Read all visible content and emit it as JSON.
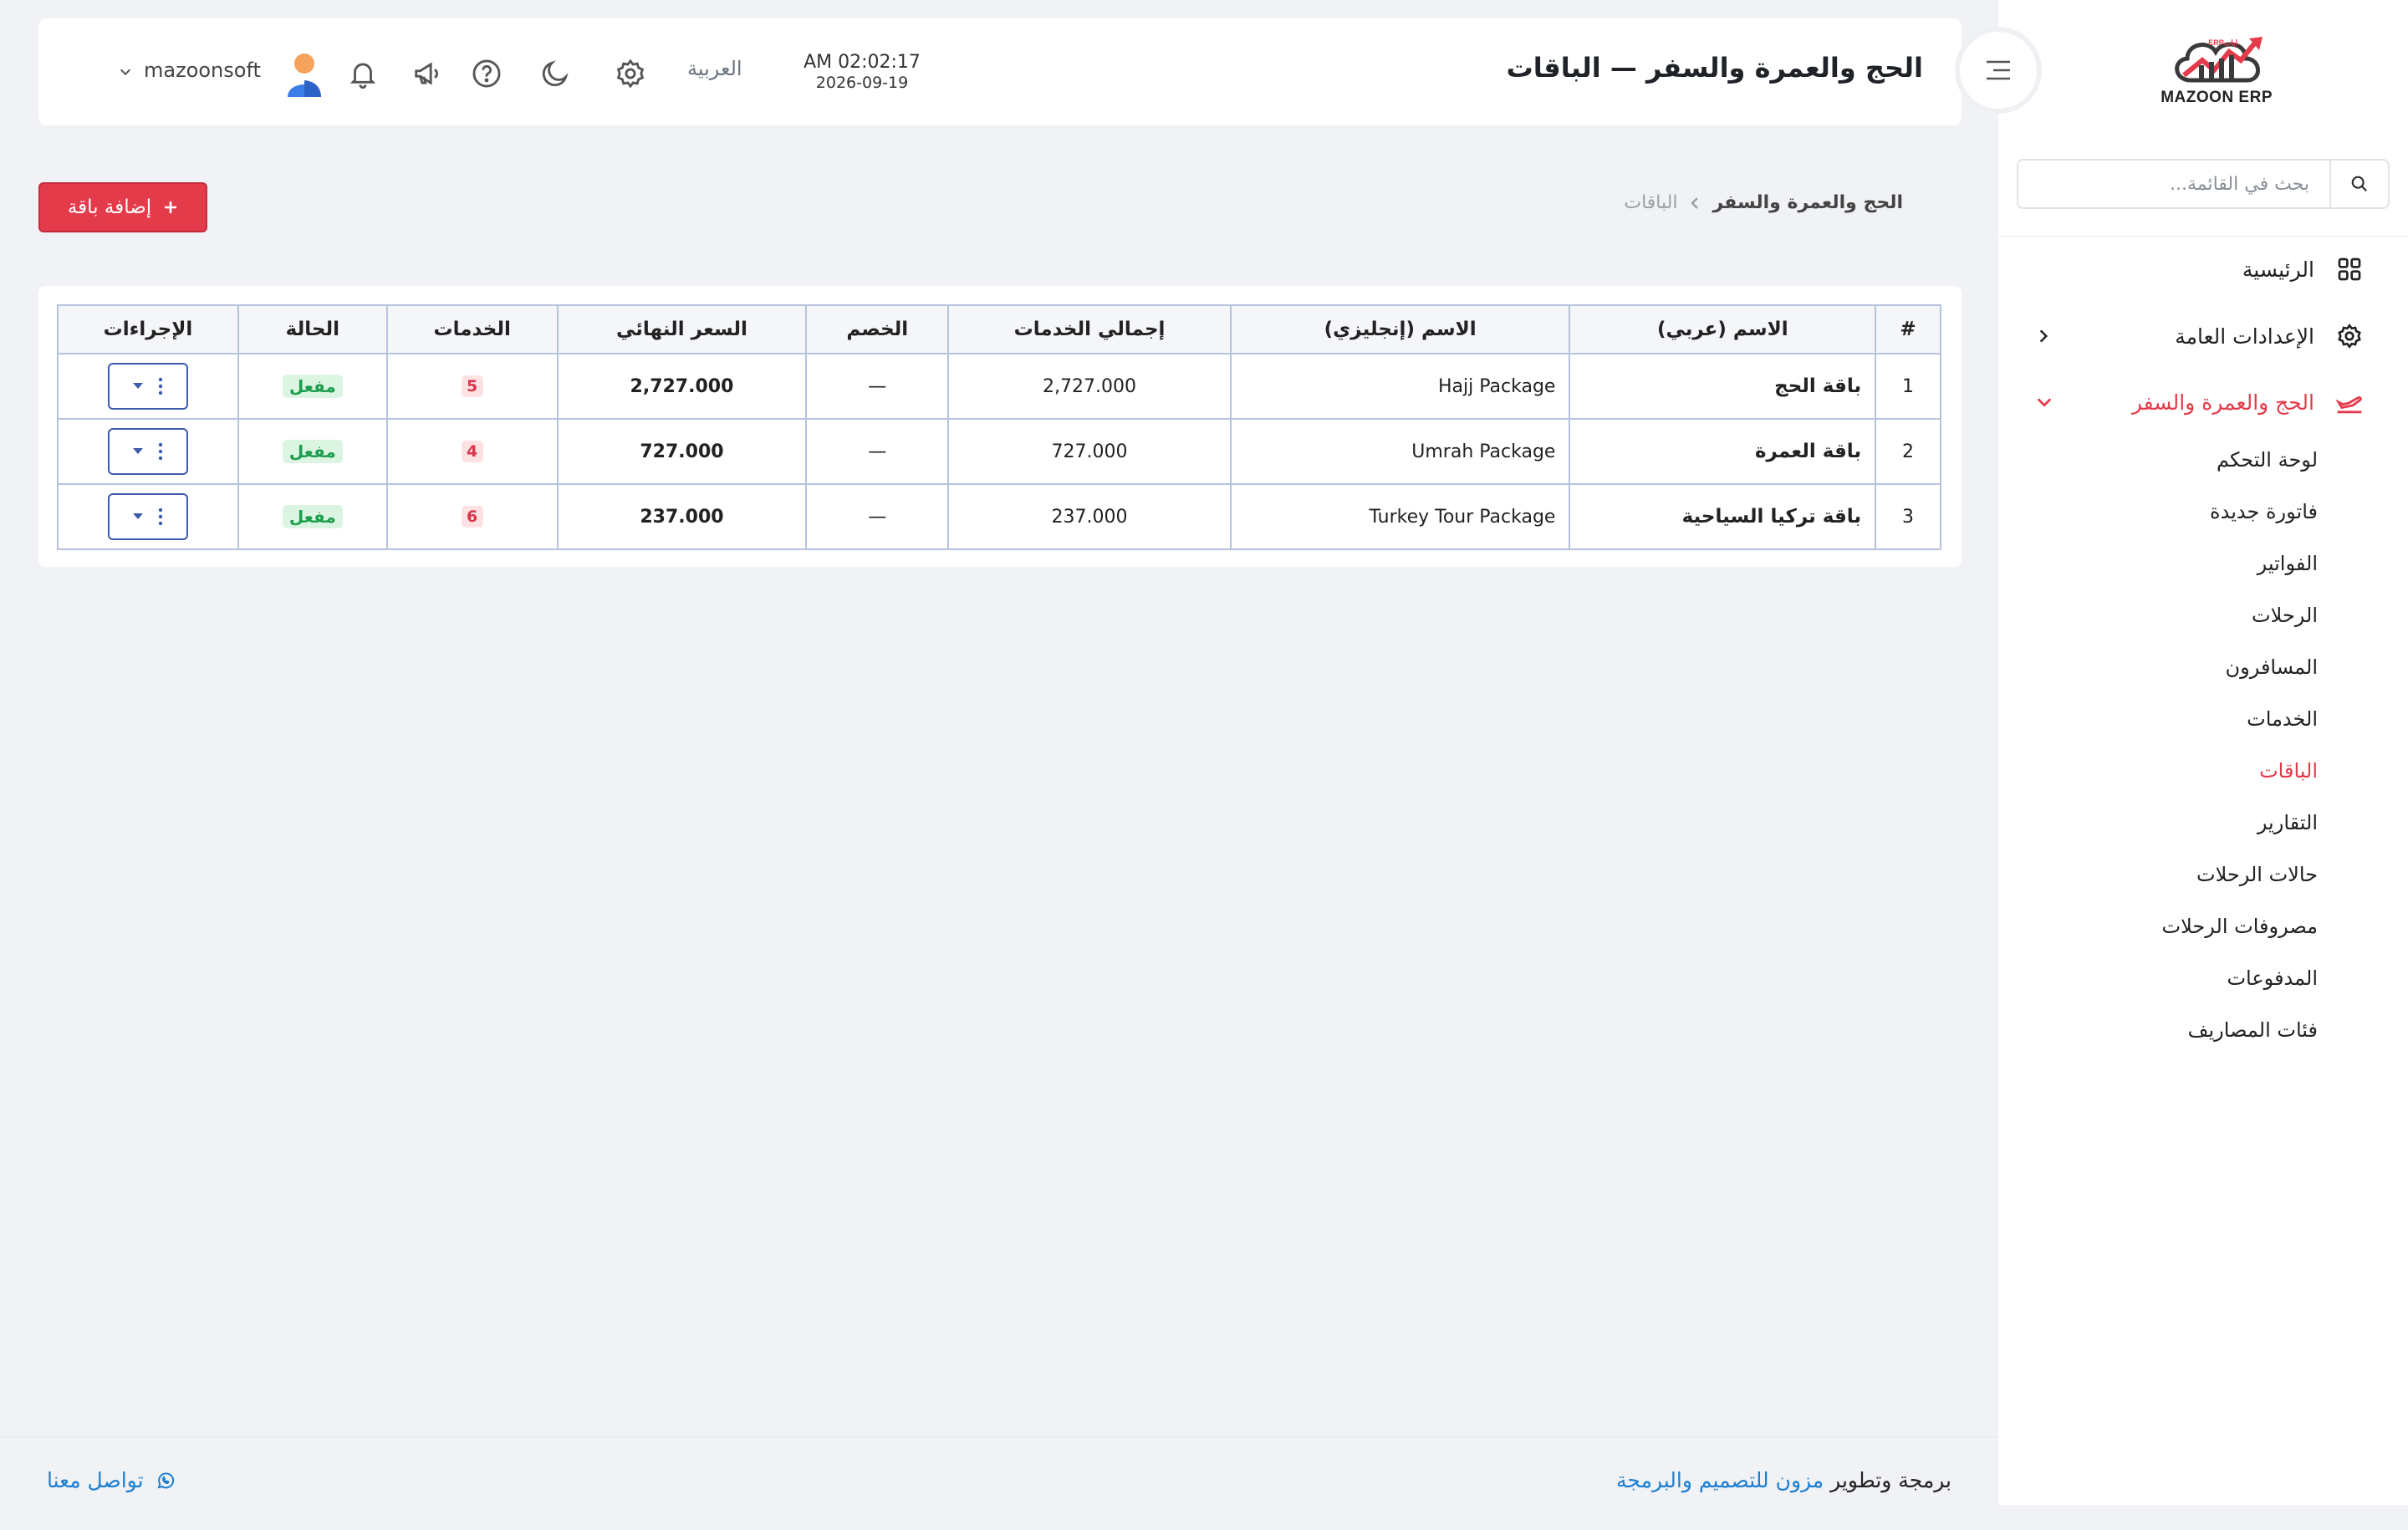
{
  "brand": {
    "name": "MAZOON ERP",
    "small": "ERPاياب"
  },
  "sidebar": {
    "search_placeholder": "بحث في القائمة...",
    "top_items": [
      {
        "label": "الرئيسية",
        "icon": "grid-icon"
      },
      {
        "label": "الإعدادات العامة",
        "icon": "gear-icon"
      },
      {
        "label": "الحج والعمرة والسفر",
        "icon": "plane-icon",
        "active": true
      }
    ],
    "sub_items": [
      {
        "label": "لوحة التحكم"
      },
      {
        "label": "فاتورة جديدة"
      },
      {
        "label": "الفواتير"
      },
      {
        "label": "الرحلات"
      },
      {
        "label": "المسافرون"
      },
      {
        "label": "الخدمات"
      },
      {
        "label": "الباقات",
        "active": true
      },
      {
        "label": "التقارير"
      },
      {
        "label": "حالات الرحلات"
      },
      {
        "label": "مصروفات الرحلات"
      },
      {
        "label": "المدفوعات"
      },
      {
        "label": "فئات المصاريف"
      }
    ]
  },
  "header": {
    "title": "الحج والعمرة والسفر — الباقات",
    "time": "AM 02:02:17",
    "date": "2026-09-19",
    "language": "العربية",
    "username": "mazoonsoft"
  },
  "breadcrumb": {
    "parent": "الحج والعمرة والسفر",
    "current": "الباقات"
  },
  "toolbar": {
    "add_label": "إضافة باقة"
  },
  "table": {
    "headers": [
      "#",
      "الاسم (عربي)",
      "الاسم (إنجليزي)",
      "إجمالي الخدمات",
      "الخصم",
      "السعر النهائي",
      "الخدمات",
      "الحالة",
      "الإجراءات"
    ],
    "rows": [
      {
        "num": "1",
        "name_ar": "باقة الحج",
        "name_en": "Hajj Package",
        "total": "2,727.000",
        "discount": "—",
        "final": "2,727.000",
        "services": "5",
        "status": "مفعل"
      },
      {
        "num": "2",
        "name_ar": "باقة العمرة",
        "name_en": "Umrah Package",
        "total": "727.000",
        "discount": "—",
        "final": "727.000",
        "services": "4",
        "status": "مفعل"
      },
      {
        "num": "3",
        "name_ar": "باقة تركيا السياحية",
        "name_en": "Turkey Tour Package",
        "total": "237.000",
        "discount": "—",
        "final": "237.000",
        "services": "6",
        "status": "مفعل"
      }
    ]
  },
  "footer": {
    "credit_prefix": "برمجة وتطوير",
    "credit_link": "مزون للتصميم والبرمجة",
    "contact": "تواصل معنا"
  },
  "colors": {
    "accent": "#e43b4b",
    "link": "#1d7fd1",
    "success": "#1e9e4e",
    "table_border": "#b5c3dc"
  }
}
